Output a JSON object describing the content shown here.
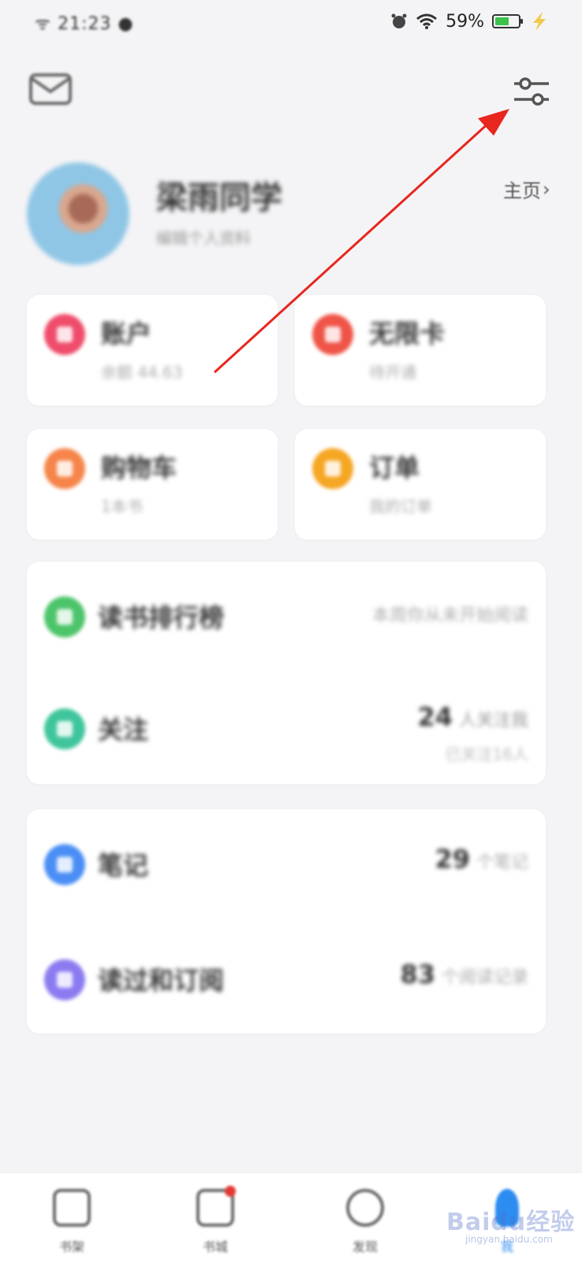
{
  "status_bar": {
    "left_text": "ᯤ 21:23 ●",
    "battery_text": "59%",
    "battery_level": 0.59,
    "icons": [
      "alarm-icon",
      "wifi-icon",
      "battery-icon",
      "charging-icon"
    ]
  },
  "header": {
    "icons": [
      "mail-icon",
      "settings-sliders-icon"
    ]
  },
  "profile": {
    "name": "梁雨同学",
    "subtitle": "编辑个人资料",
    "home_link": "主页",
    "home_chevron": "›"
  },
  "grid_cards": [
    {
      "title": "账户",
      "subtitle": "余额 44.63",
      "color": "#ef4c6b",
      "icon": "wallet-icon"
    },
    {
      "title": "无限卡",
      "subtitle": "待开通",
      "color": "#ef5447",
      "icon": "diamond-icon"
    },
    {
      "title": "购物车",
      "subtitle": "1本书",
      "color": "#f5854a",
      "icon": "cart-icon"
    },
    {
      "title": "订单",
      "subtitle": "我的订单",
      "color": "#f5a623",
      "icon": "order-icon"
    }
  ],
  "list_group_1": [
    {
      "title": "读书排行榜",
      "right": "本周你从未开始阅读",
      "color": "#4cc46a",
      "icon": "ranking-icon"
    },
    {
      "title": "关注",
      "number": "24",
      "right": "人关注我",
      "right_sub": "已关注16人",
      "color": "#3fc59c",
      "icon": "follow-icon"
    }
  ],
  "list_group_2": [
    {
      "title": "笔记",
      "number": "29",
      "right": "个笔记",
      "color": "#4a8ef5",
      "icon": "pen-icon"
    },
    {
      "title": "读过和订阅",
      "number": "83",
      "right": "个阅读记录",
      "color": "#8a7cf0",
      "icon": "book-icon"
    }
  ],
  "tabbar": {
    "tabs": [
      {
        "label": "书架",
        "icon": "bookshelf-icon"
      },
      {
        "label": "书城",
        "icon": "store-icon"
      },
      {
        "label": "发现",
        "icon": "compass-icon"
      },
      {
        "label": "我",
        "icon": "person-icon"
      }
    ]
  },
  "annotation_color": "#e8261e",
  "watermark": {
    "main": "Baidu经验",
    "sub": "jingyan.baidu.com"
  }
}
